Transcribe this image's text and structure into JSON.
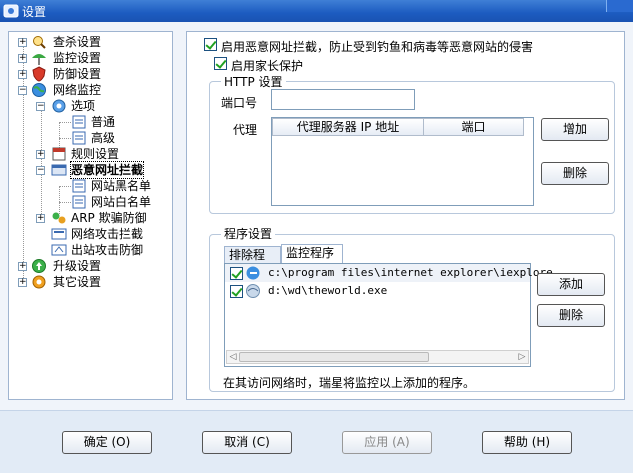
{
  "window": {
    "title": "设置"
  },
  "tree": [
    {
      "label": "查杀设置"
    },
    {
      "label": "监控设置"
    },
    {
      "label": "防御设置"
    },
    {
      "label": "网络监控"
    },
    {
      "label": "选项"
    },
    {
      "label": "普通"
    },
    {
      "label": "高级"
    },
    {
      "label": "规则设置"
    },
    {
      "label": "恶意网址拦截"
    },
    {
      "label": "网站黑名单"
    },
    {
      "label": "网站白名单"
    },
    {
      "label": "ARP 欺骗防御"
    },
    {
      "label": "网络攻击拦截"
    },
    {
      "label": "出站攻击防御"
    },
    {
      "label": "升级设置"
    },
    {
      "label": "其它设置"
    }
  ],
  "main": {
    "enable_block_label": "启用恶意网址拦截，防止受到钓鱼和病毒等恶意网站的侵害",
    "enable_parental_label": "启用家长保护",
    "http_group_title": "HTTP 设置",
    "port_label": "端口号",
    "port_value": "",
    "proxy_label": "代理",
    "proxy_columns": [
      "代理服务器 IP 地址",
      "端口"
    ],
    "add_button": "增加",
    "delete_button": "删除",
    "program_group_title": "程序设置",
    "tabs": [
      "排除程序",
      "监控程序"
    ],
    "programs": [
      {
        "path": "c:\\program files\\internet explorer\\iexplore."
      },
      {
        "path": "d:\\wd\\theworld.exe"
      }
    ],
    "program_add_button": "添加",
    "program_delete_button": "删除",
    "footer_note": "在其访问网络时，瑞星将监控以上添加的程序。"
  },
  "footer": {
    "ok": "确定 (O)",
    "cancel": "取消 (C)",
    "apply": "应用 (A)",
    "help": "帮助 (H)"
  },
  "colors": {
    "accent": "#1c5bc0",
    "check": "#21a121"
  }
}
